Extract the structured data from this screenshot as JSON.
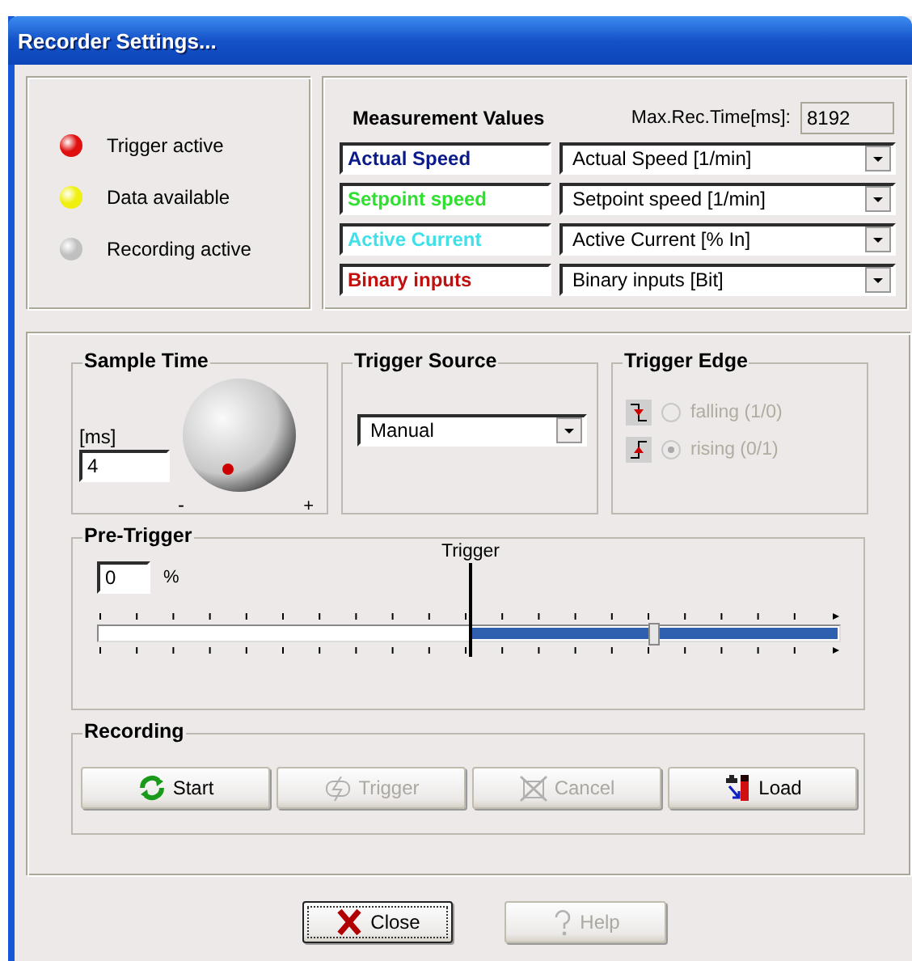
{
  "window": {
    "title": "Recorder Settings..."
  },
  "indicators": [
    {
      "label": "Trigger active",
      "color": "#e01010"
    },
    {
      "label": "Data available",
      "color": "#f0f010"
    },
    {
      "label": "Recording active",
      "color": "#c0c0c0"
    }
  ],
  "measurement": {
    "title": "Measurement Values",
    "max_label": "Max.Rec.Time[ms]:",
    "max_value": "8192",
    "rows": [
      {
        "name": "Actual Speed",
        "color": "#0a1a8a",
        "value": "Actual Speed [1/min]"
      },
      {
        "name": "Setpoint speed",
        "color": "#30e030",
        "value": "Setpoint speed [1/min]"
      },
      {
        "name": "Active Current",
        "color": "#40e0e8",
        "value": "Active Current [% In]"
      },
      {
        "name": "Binary inputs",
        "color": "#c01010",
        "value": "Binary inputs [Bit]"
      }
    ]
  },
  "sample_time": {
    "title": "Sample Time",
    "unit": "[ms]",
    "value": "4",
    "minus": "-",
    "plus": "+"
  },
  "trigger_source": {
    "title": "Trigger Source",
    "value": "Manual"
  },
  "trigger_edge": {
    "title": "Trigger Edge",
    "options": [
      {
        "label": "falling (1/0)",
        "kind": "falling",
        "selected": false,
        "disabled": true
      },
      {
        "label": "rising (0/1)",
        "kind": "rising",
        "selected": true,
        "disabled": true
      }
    ]
  },
  "pre_trigger": {
    "title": "Pre-Trigger",
    "value": "0",
    "unit": "%",
    "marker": "Trigger",
    "level": 0.75
  },
  "recording": {
    "title": "Recording",
    "buttons": [
      {
        "label": "Start",
        "kind": "start",
        "disabled": false
      },
      {
        "label": "Trigger",
        "kind": "trigger",
        "disabled": true
      },
      {
        "label": "Cancel",
        "kind": "cancel",
        "disabled": true
      },
      {
        "label": "Load",
        "kind": "load",
        "disabled": false
      }
    ]
  },
  "buttons": [
    {
      "label": "Close",
      "kind": "close",
      "disabled": false
    },
    {
      "label": "Help",
      "kind": "help",
      "disabled": true
    }
  ]
}
